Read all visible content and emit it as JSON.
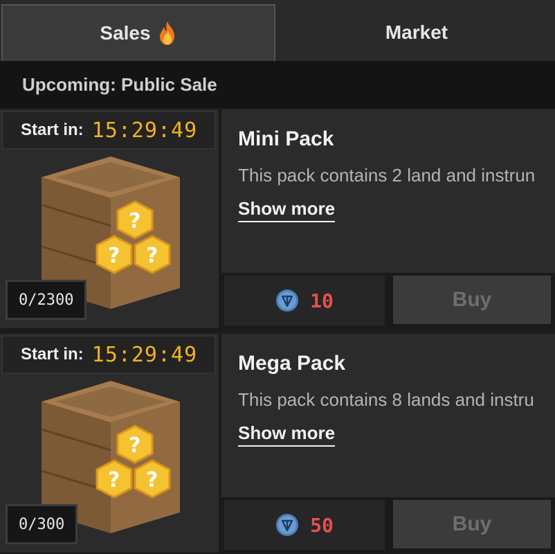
{
  "tabs": [
    {
      "label": "Sales",
      "active": true,
      "icon": "flame-icon"
    },
    {
      "label": "Market",
      "active": false
    }
  ],
  "section": {
    "label": "Upcoming: Public Sale"
  },
  "packs": [
    {
      "start_label": "Start in:",
      "timer": "15:29:49",
      "count": "0/2300",
      "title": "Mini Pack",
      "description": "This pack contains 2 land and instrun",
      "show_more": "Show more",
      "price": "10",
      "currency_icon": "ton-coin-icon",
      "buy_label": "Buy"
    },
    {
      "start_label": "Start in:",
      "timer": "15:29:49",
      "count": "0/300",
      "title": "Mega Pack",
      "description": "This pack contains 8 lands and instru",
      "show_more": "Show more",
      "price": "50",
      "currency_icon": "ton-coin-icon",
      "buy_label": "Buy"
    }
  ],
  "colors": {
    "timer": "#f2b31b",
    "price": "#e0534f",
    "buy_disabled_text": "#6e6e6e"
  }
}
